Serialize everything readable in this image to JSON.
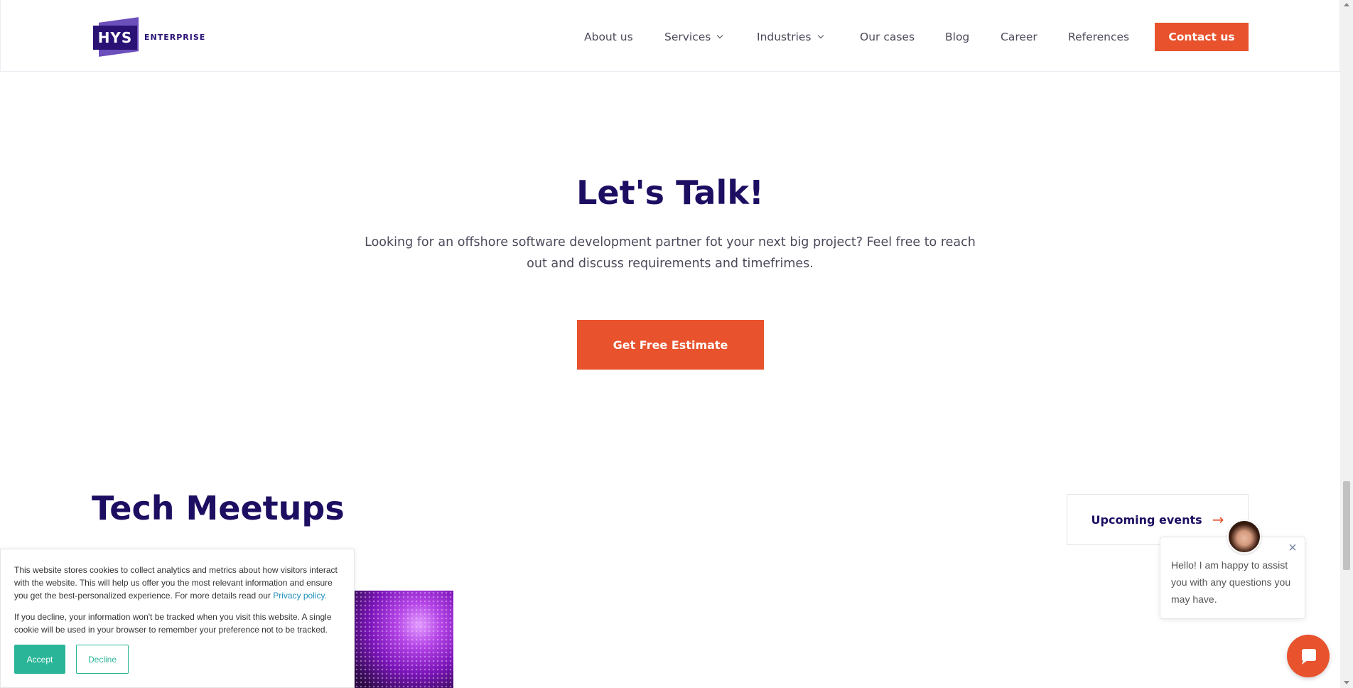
{
  "header": {
    "logo_mark": "HYS",
    "logo_word": "ENTERPRISE",
    "nav": [
      {
        "label": "About us"
      },
      {
        "label": "Services"
      },
      {
        "label": "Industries"
      },
      {
        "label": "Our cases"
      },
      {
        "label": "Blog"
      },
      {
        "label": "Career"
      },
      {
        "label": "References"
      }
    ],
    "contact_label": "Contact us"
  },
  "talk": {
    "title": "Let's Talk!",
    "text": "Looking for an offshore software development partner fot your next big project? Feel free to reach out and discuss requirements and timefrimes.",
    "button_label": "Get Free Estimate"
  },
  "meetups": {
    "title": "Tech Meetups",
    "upcoming_label": "Upcoming events",
    "arrow_icon": "arrow-right-icon"
  },
  "cookie": {
    "text1": "This website stores cookies to collect analytics and metrics about how visitors interact with the website. This will help us offer you the most relevant information and ensure you get the best-personalized experience. For more details read our ",
    "link": "Privacy policy.",
    "text2": "If you decline, your information won't be tracked when you visit this website. A single cookie will be used in your browser to remember your preference not to be tracked.",
    "accept_label": "Accept",
    "decline_label": "Decline"
  },
  "chat": {
    "message": "Hello! I am happy to assist you with any questions you may have.",
    "close_icon": "×"
  },
  "colors": {
    "accent": "#e8522c",
    "brand": "#1e0e62",
    "cookie_accent": "#2ab598"
  }
}
